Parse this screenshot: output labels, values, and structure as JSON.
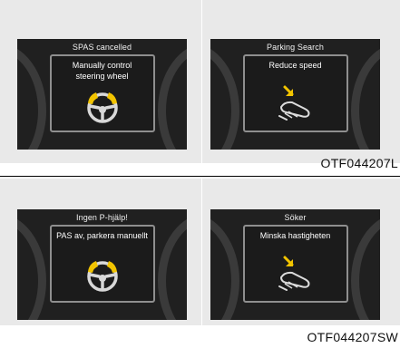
{
  "top": {
    "left_panel": {
      "title": "SPAS cancelled",
      "message": "Manually control\nsteering wheel",
      "icon": "steering-wheel-icon"
    },
    "right_panel": {
      "title": "Parking Search",
      "message": "Reduce speed",
      "icon": "foot-on-brake-icon"
    },
    "code": "OTF044207L"
  },
  "bottom": {
    "left_panel": {
      "title": "Ingen P-hjälp!",
      "message": "PAS av, parkera manuellt",
      "icon": "steering-wheel-icon"
    },
    "right_panel": {
      "title": "Söker",
      "message": "Minska hastigheten",
      "icon": "foot-on-brake-icon"
    },
    "code": "OTF044207SW"
  },
  "colors": {
    "background": "#e9e9e9",
    "panel": "#202020",
    "accent": "#f2c400"
  }
}
